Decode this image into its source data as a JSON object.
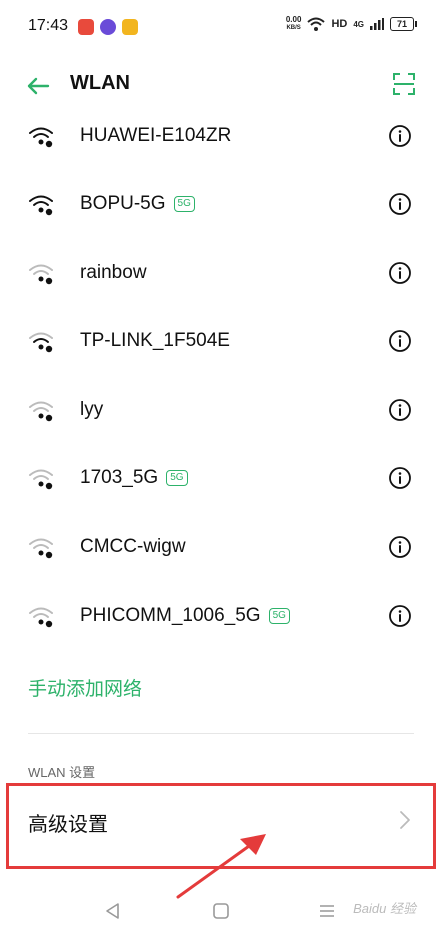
{
  "status_bar": {
    "time": "17:43",
    "net_speed_value": "0.00",
    "net_speed_unit": "KB/S",
    "hd_label": "HD",
    "signal_label": "4G",
    "battery_level": "71"
  },
  "app_bar": {
    "title": "WLAN"
  },
  "networks": [
    {
      "ssid": "HUAWEI-E104ZR",
      "badge": ""
    },
    {
      "ssid": "BOPU-5G",
      "badge": "5G"
    },
    {
      "ssid": "rainbow",
      "badge": ""
    },
    {
      "ssid": "TP-LINK_1F504E",
      "badge": ""
    },
    {
      "ssid": "lyy",
      "badge": ""
    },
    {
      "ssid": "1703_5G",
      "badge": "5G"
    },
    {
      "ssid": "CMCC-wigw",
      "badge": ""
    },
    {
      "ssid": "PHICOMM_1006_5G",
      "badge": "5G"
    }
  ],
  "add_network_label": "手动添加网络",
  "section_header": "WLAN 设置",
  "advanced_settings_label": "高级设置",
  "watermark": "Baidu 经验",
  "colors": {
    "accent": "#2db26a",
    "highlight": "#e43b3b"
  }
}
